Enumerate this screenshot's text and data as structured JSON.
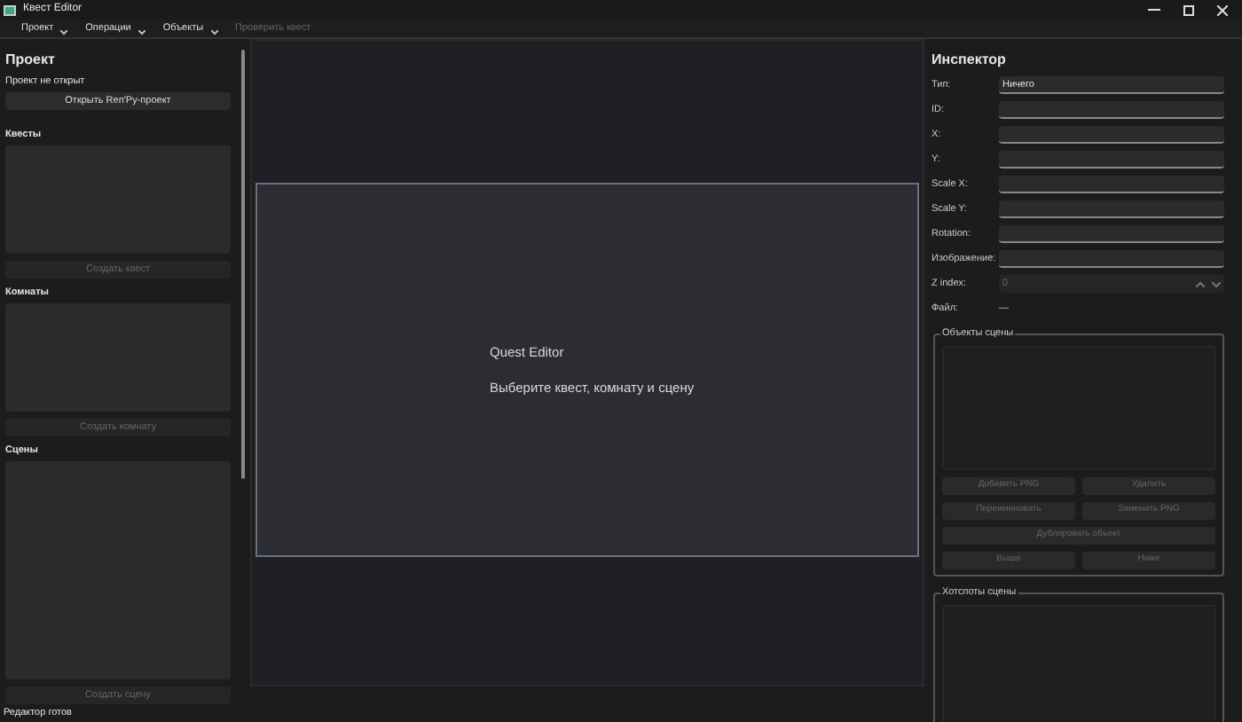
{
  "window": {
    "title": "Квест Editor"
  },
  "menu": [
    {
      "label": "Проект",
      "kind": "dropdown",
      "disabled": false
    },
    {
      "label": "Операции",
      "kind": "dropdown",
      "disabled": false
    },
    {
      "label": "Объекты",
      "kind": "dropdown",
      "disabled": false
    },
    {
      "label": "Проверить квест",
      "kind": "action",
      "disabled": true
    }
  ],
  "project_panel": {
    "title": "Проект",
    "status": "Проект не открыт",
    "open_button": "Открыть Ren'Py-проект",
    "sections": [
      {
        "title": "Квесты",
        "button": {
          "label": "Создать квест",
          "disabled": true
        }
      },
      {
        "title": "Комнаты",
        "button": {
          "label": "Создать комнату",
          "disabled": true
        }
      },
      {
        "title": "Сцены",
        "button": {
          "label": "Создать сцену",
          "disabled": true
        }
      }
    ]
  },
  "canvas": {
    "title": "Quest Editor",
    "message": "Выберите квест, комнату и сцену"
  },
  "inspector": {
    "title": "Инспектор",
    "fields": [
      {
        "label": "Тип:",
        "kind": "text",
        "value": "Ничего"
      },
      {
        "label": "ID:",
        "kind": "text"
      },
      {
        "label": "X:",
        "kind": "text"
      },
      {
        "label": "Y:",
        "kind": "text"
      },
      {
        "label": "Scale X:",
        "kind": "text"
      },
      {
        "label": "Scale Y:",
        "kind": "text"
      },
      {
        "label": "Rotation:",
        "kind": "text"
      },
      {
        "label": "Изображение:",
        "kind": "text"
      },
      {
        "label": "Z index:",
        "kind": "spin",
        "value": "0",
        "disabled": true
      },
      {
        "label": "Файл:",
        "kind": "static",
        "value": "—"
      }
    ],
    "objects_group": {
      "title": "Объекты сцены",
      "buttons": [
        [
          "Добавить PNG",
          "Удалить"
        ],
        [
          "Переименовать",
          "Заменить PNG"
        ],
        [
          "Дублировать объект"
        ],
        [
          "Выше",
          "Ниже"
        ]
      ],
      "disabled": true
    },
    "hotspots_group": {
      "title": "Хотспоты сцены"
    }
  },
  "status_bar": "Редактор готов"
}
